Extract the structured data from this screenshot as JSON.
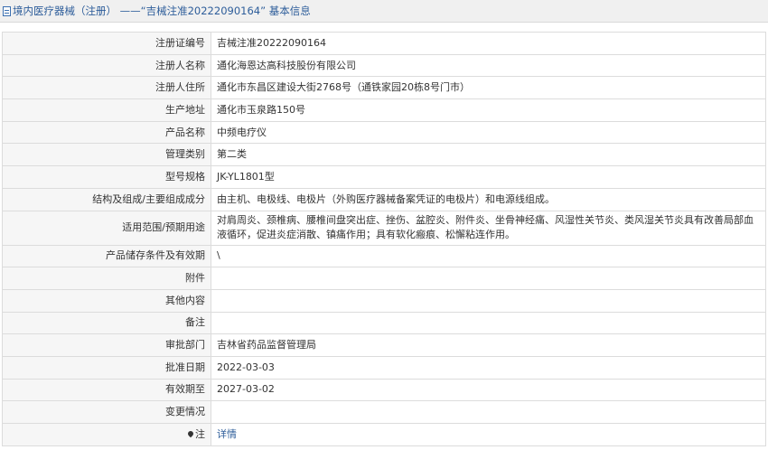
{
  "header": {
    "title": "境内医疗器械（注册） ——“吉械注准20222090164” 基本信息"
  },
  "rows": [
    {
      "label": "注册证编号",
      "value": "吉械注准20222090164"
    },
    {
      "label": "注册人名称",
      "value": "通化海恩达高科技股份有限公司"
    },
    {
      "label": "注册人住所",
      "value": "通化市东昌区建设大街2768号（通铁家园20栋8号门市）"
    },
    {
      "label": "生产地址",
      "value": "通化市玉泉路150号"
    },
    {
      "label": "产品名称",
      "value": "中频电疗仪"
    },
    {
      "label": "管理类别",
      "value": "第二类"
    },
    {
      "label": "型号规格",
      "value": "JK-YL1801型"
    },
    {
      "label": "结构及组成/主要组成成分",
      "value": "由主机、电极线、电极片（外购医疗器械备案凭证的电极片）和电源线组成。"
    },
    {
      "label": "适用范围/预期用途",
      "value": "对肩周炎、颈椎病、腰椎间盘突出症、挫伤、盆腔炎、附件炎、坐骨神经痛、风湿性关节炎、类风湿关节炎具有改善局部血液循环，促进炎症消散、镇痛作用；具有软化瘢痕、松懈粘连作用。"
    },
    {
      "label": "产品储存条件及有效期",
      "value": "\\"
    },
    {
      "label": "附件",
      "value": ""
    },
    {
      "label": "其他内容",
      "value": ""
    },
    {
      "label": "备注",
      "value": ""
    },
    {
      "label": "审批部门",
      "value": "吉林省药品监督管理局"
    },
    {
      "label": "批准日期",
      "value": "2022-03-03"
    },
    {
      "label": "有效期至",
      "value": "2027-03-02"
    },
    {
      "label": "变更情况",
      "value": ""
    },
    {
      "label": "注",
      "value": "详情"
    }
  ]
}
